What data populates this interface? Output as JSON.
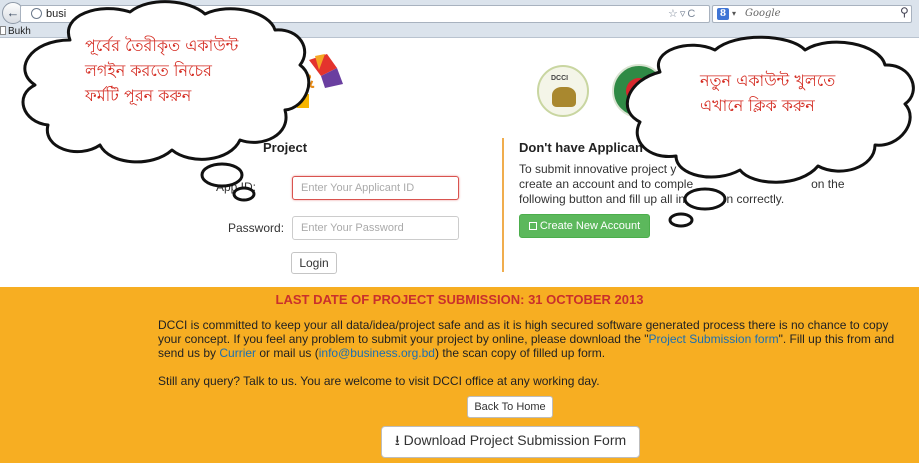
{
  "browser": {
    "url_text": "busi",
    "search_placeholder": "Google",
    "bookmark": "Bukh",
    "icons": [
      "back-arrow-icon",
      "globe-icon",
      "star-icon",
      "refresh-icon",
      "google-icon",
      "search-icon"
    ]
  },
  "login": {
    "heading": "Project",
    "applicant_label": "App       ID:",
    "applicant_placeholder": "Enter Your Applicant ID",
    "password_label": "Password:",
    "password_placeholder": "Enter Your Password",
    "login_button": "Login"
  },
  "signup": {
    "heading": "Don't have Applican",
    "text_line1": "To submit innovative project y",
    "text_line2": "create an account and to comple",
    "text_line2b": "on the",
    "text_line3": "following button and fill up all inf",
    "text_line3b": "n correctly.",
    "create_button": "Create New Account"
  },
  "notice": {
    "deadline": "LAST DATE OF PROJECT SUBMISSION: 31 OCTOBER 2013",
    "para_part1": "DCCI is committed to keep your all data/idea/project safe and as it is high secured software generated process there is no chance to copy your concept. If you feel any problem to submit your project by online, please download the \"",
    "para_link1": "Project Submission form",
    "para_part2": "\". Fill up this from and send us by ",
    "para_link2": "Currier",
    "para_part3": " or mail us (",
    "para_link3": "info@business.org.bd",
    "para_part4": ") the scan copy of filled up form.",
    "still_query": "Still any query? Talk to us. You are welcome to visit DCCI office at any working day.",
    "home_button": "Back To Home",
    "download_button": "Download Project Submission Form"
  },
  "annotations": {
    "left_line1": "পূর্বের তৈরীকৃত একাউন্ট",
    "left_line2": "লগইন করতে নিচের",
    "left_line3": "ফর্মটি পূরন করুন",
    "right_line1": "নতুন একাউন্ট খুলতে",
    "right_line2": "এখানে ক্লিক করুন"
  },
  "logos": {
    "dcci_text": "DCCI"
  },
  "colors": {
    "band": "#f7ae22",
    "deadline": "#c9302c",
    "create_button": "#5cb85c",
    "annotation_text": "#d42a20",
    "link": "#1a6fb3"
  }
}
